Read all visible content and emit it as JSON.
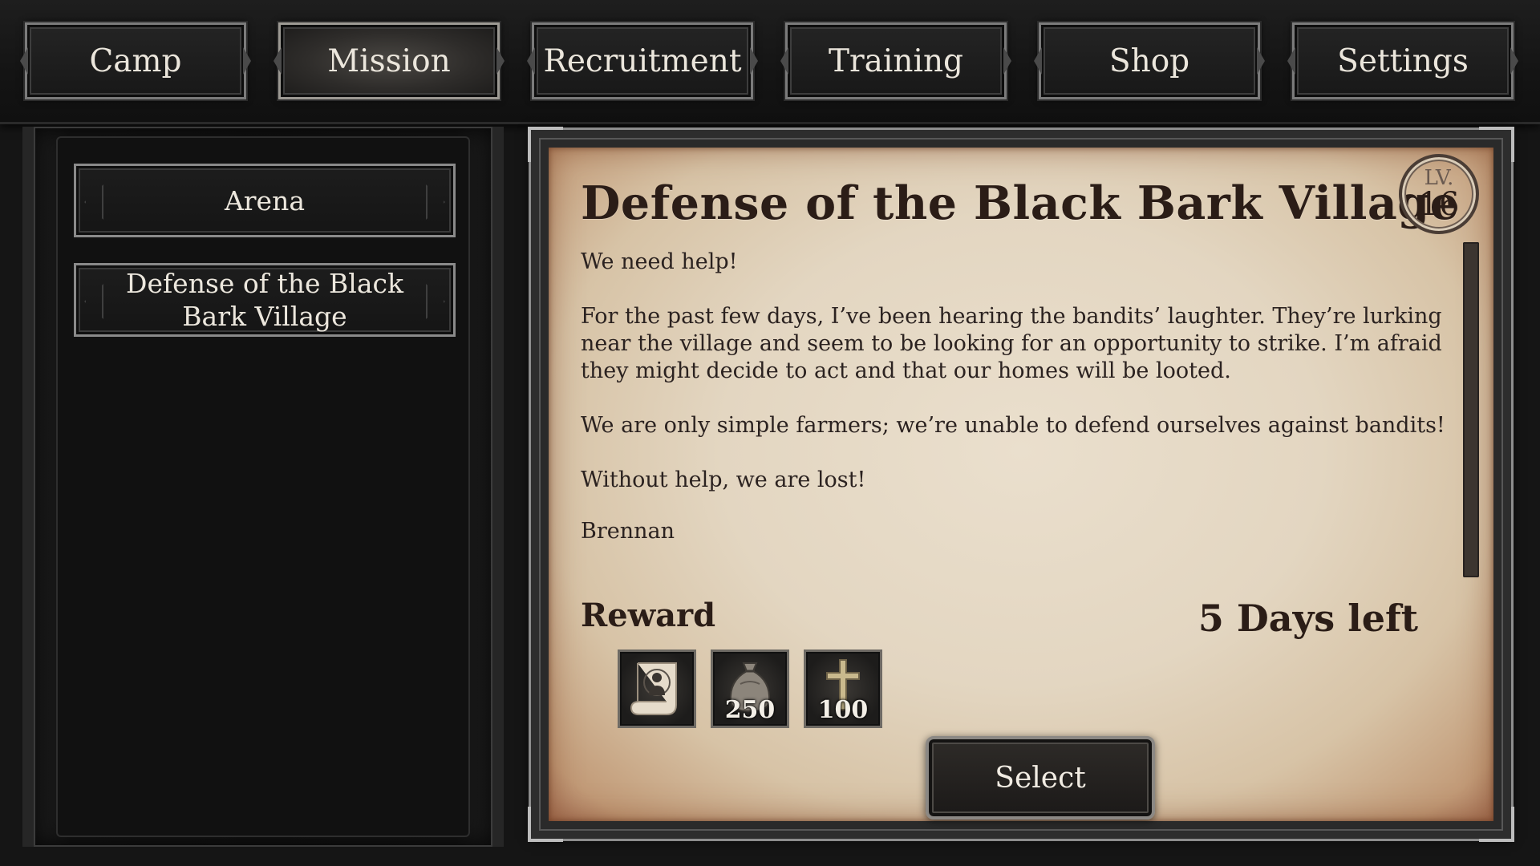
{
  "nav": {
    "tabs": [
      {
        "label": "Camp"
      },
      {
        "label": "Mission"
      },
      {
        "label": "Recruitment"
      },
      {
        "label": "Training"
      },
      {
        "label": "Shop"
      },
      {
        "label": "Settings"
      }
    ],
    "active": "Mission"
  },
  "missions": {
    "items": [
      {
        "label": "Arena"
      },
      {
        "label": "Defense of the Black Bark Village"
      }
    ]
  },
  "detail": {
    "title": "Defense of the Black Bark Village",
    "level_label": "LV.",
    "level": "16",
    "paragraphs": [
      "We need help!",
      "For the past few days, I’ve been hearing the bandits’ laughter. They’re lurking near the village and seem to be looking for an opportunity to strike. I’m afraid they might decide to act and that our homes will be looted.",
      "We are only simple farmers; we’re unable to defend ourselves against bandits!",
      "Without help, we are lost!",
      "Brennan"
    ],
    "reward_label": "Reward",
    "days_left": "5 Days left",
    "rewards": [
      {
        "icon": "recruit-scroll-icon",
        "amount": ""
      },
      {
        "icon": "coin-bag-icon",
        "amount": "250"
      },
      {
        "icon": "cross-icon",
        "amount": "100"
      }
    ],
    "select_label": "Select"
  }
}
